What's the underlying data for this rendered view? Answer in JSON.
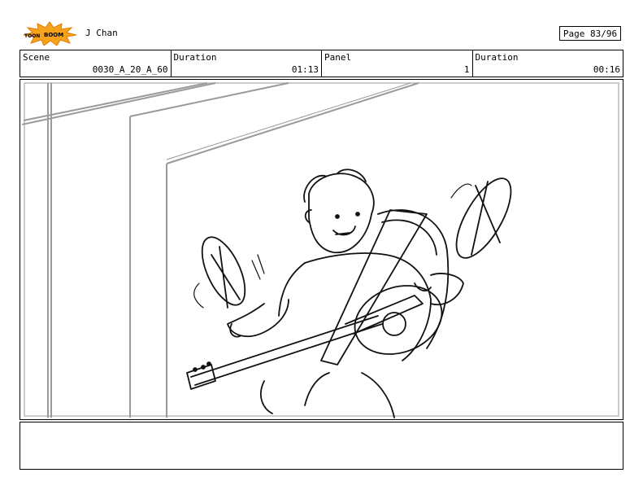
{
  "header": {
    "logo_text": "TOONBOOM",
    "show_title": "J Chan",
    "page_label": "Page 83/96"
  },
  "info": {
    "scene_label": "Scene",
    "scene_value": "0030_A_20_A_60",
    "duration1_label": "Duration",
    "duration1_value": "01:13",
    "panel_label": "Panel",
    "panel_value": "1",
    "duration2_label": "Duration",
    "duration2_value": "00:16"
  },
  "notes": {
    "text": ""
  }
}
